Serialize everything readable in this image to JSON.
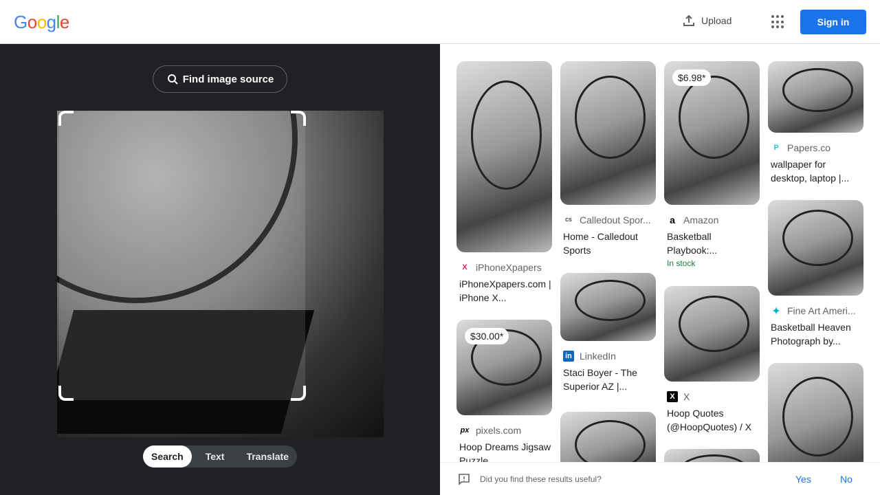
{
  "header": {
    "logo": "Google",
    "upload": "Upload",
    "sign_in": "Sign in"
  },
  "lens": {
    "find_source": "Find image source",
    "tabs": [
      "Search",
      "Text",
      "Translate"
    ]
  },
  "results": [
    {
      "source": "iPhoneXpapers",
      "title": "iPhoneXpapers.com | iPhone X...",
      "favicon": "X"
    },
    {
      "source": "pixels.com",
      "title": "Hoop Dreams Jigsaw Puzzle",
      "favicon": "px",
      "price": "$30.00*"
    },
    {
      "source": "Calledout Spor...",
      "title": "Home - Calledout Sports",
      "favicon": "CS"
    },
    {
      "source": "LinkedIn",
      "title": "Staci Boyer - The Superior AZ |...",
      "favicon": "in"
    },
    {
      "source": "Amazon",
      "title": "Basketball Playbook:...",
      "favicon": "a",
      "price": "$6.98*",
      "stock": "In stock"
    },
    {
      "source": "X",
      "title": "Hoop Quotes (@HoopQuotes) / X",
      "favicon": "X"
    },
    {
      "source": "Papers.co",
      "title": "wallpaper for desktop, laptop |...",
      "favicon": "P"
    },
    {
      "source": "Fine Art Ameri...",
      "title": "Basketball Heaven Photograph by...",
      "favicon": "✦"
    }
  ],
  "feedback": {
    "question": "Did you find these results useful?",
    "yes": "Yes",
    "no": "No"
  },
  "colors": {
    "accent": "#1a73e8",
    "dark_panel": "#202124"
  }
}
